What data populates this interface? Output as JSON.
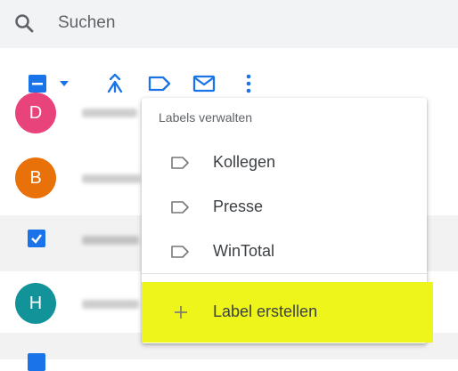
{
  "search": {
    "placeholder": "Suchen"
  },
  "toolbar": {
    "icons": [
      "select-all-checkbox",
      "chevron-down-icon",
      "merge-icon",
      "label-icon",
      "mail-icon",
      "more-vert-icon"
    ]
  },
  "contacts": [
    {
      "initial": "D",
      "color": "#e8437a"
    },
    {
      "initial": "B",
      "color": "#e8710a"
    },
    {
      "initial": "",
      "color": "#1a73e8"
    },
    {
      "initial": "H",
      "color": "#12939a"
    }
  ],
  "menu": {
    "title": "Labels verwalten",
    "labels": [
      "Kollegen",
      "Presse",
      "WinTotal"
    ],
    "create_label": "Label erstellen"
  },
  "colors": {
    "accent": "#1a73e8",
    "highlight": "#eef51a"
  }
}
